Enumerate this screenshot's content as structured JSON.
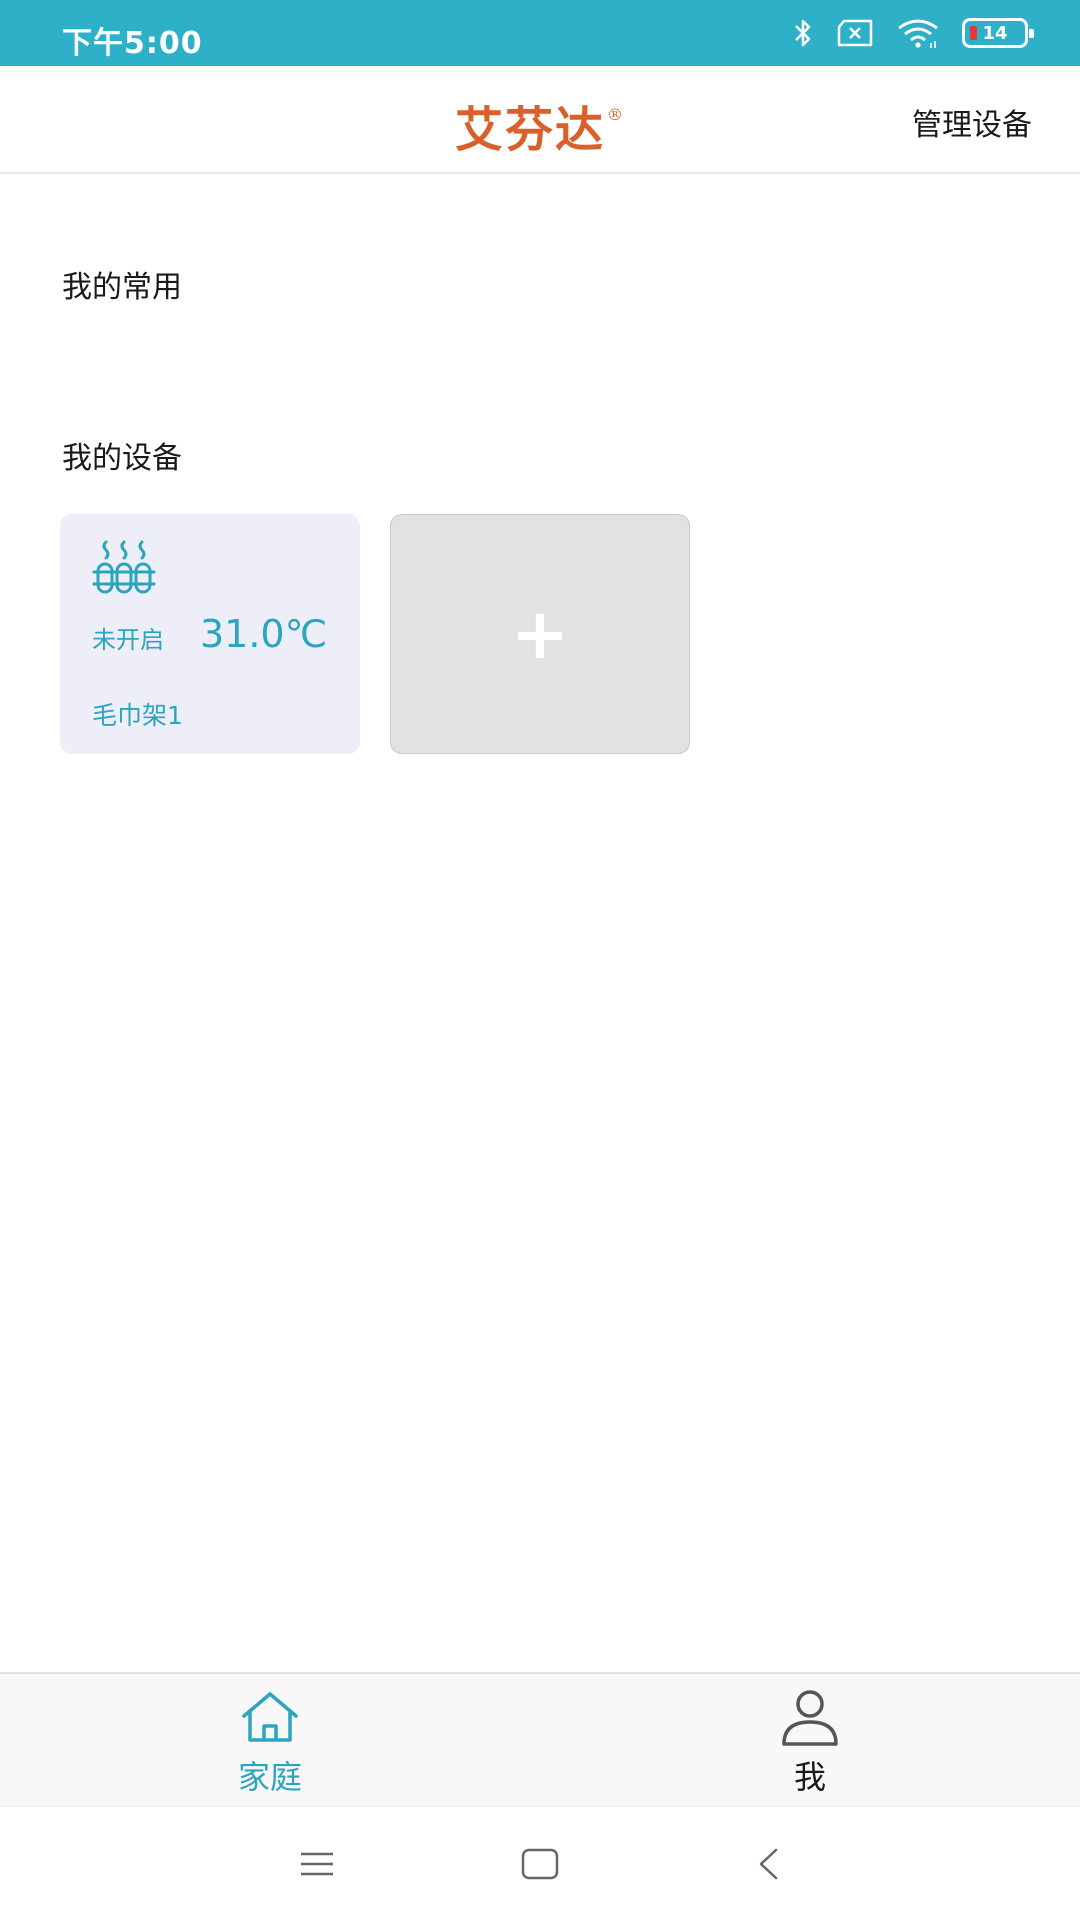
{
  "status_bar": {
    "time": "下午5:00",
    "battery_level": "14",
    "icons": [
      "bluetooth-icon",
      "sim-error-icon",
      "wifi-icon",
      "battery-icon"
    ]
  },
  "header": {
    "logo_text": "艾芬达",
    "logo_mark": "®",
    "manage_label": "管理设备"
  },
  "sections": {
    "favorites_title": "我的常用",
    "devices_title": "我的设备"
  },
  "devices": [
    {
      "icon": "towel-rack-icon",
      "status": "未开启",
      "temperature": "31.0℃",
      "name": "毛巾架1"
    }
  ],
  "add_device": {
    "label": "+"
  },
  "tab_bar": {
    "tabs": [
      {
        "icon": "home-icon",
        "label": "家庭",
        "active": true
      },
      {
        "icon": "person-icon",
        "label": "我",
        "active": false
      }
    ]
  },
  "nav_bar": {
    "icons": [
      "menu-icon",
      "home-square-icon",
      "back-icon"
    ]
  },
  "colors": {
    "status_bar": "#2eb0c8",
    "accent": "#2aa5bd",
    "brand": "#d9602b",
    "device_card_bg": "#eeeef8",
    "add_card_bg": "#e2e2e2"
  }
}
